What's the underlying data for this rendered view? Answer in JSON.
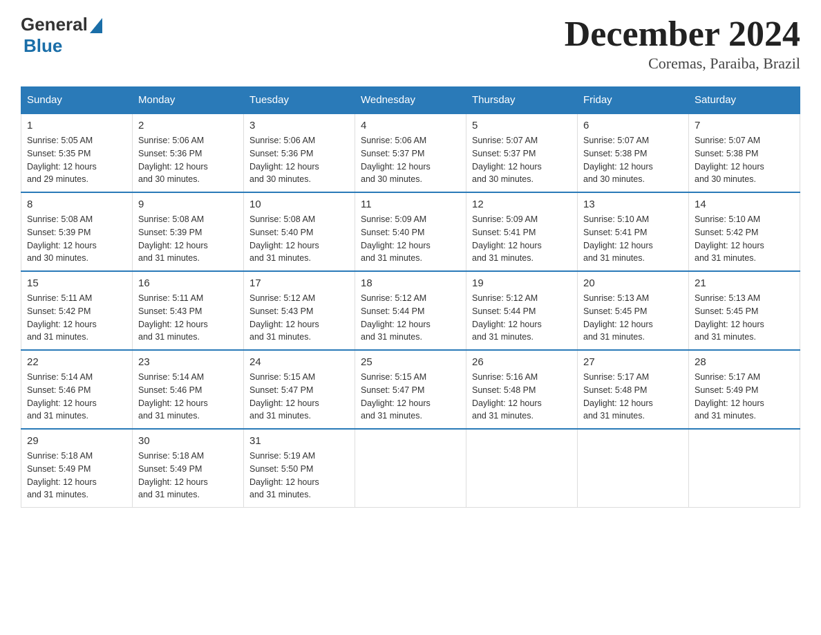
{
  "header": {
    "logo_general": "General",
    "logo_blue": "Blue",
    "title": "December 2024",
    "subtitle": "Coremas, Paraiba, Brazil"
  },
  "days_of_week": [
    "Sunday",
    "Monday",
    "Tuesday",
    "Wednesday",
    "Thursday",
    "Friday",
    "Saturday"
  ],
  "weeks": [
    [
      {
        "day": "1",
        "sunrise": "5:05 AM",
        "sunset": "5:35 PM",
        "daylight": "12 hours and 29 minutes."
      },
      {
        "day": "2",
        "sunrise": "5:06 AM",
        "sunset": "5:36 PM",
        "daylight": "12 hours and 30 minutes."
      },
      {
        "day": "3",
        "sunrise": "5:06 AM",
        "sunset": "5:36 PM",
        "daylight": "12 hours and 30 minutes."
      },
      {
        "day": "4",
        "sunrise": "5:06 AM",
        "sunset": "5:37 PM",
        "daylight": "12 hours and 30 minutes."
      },
      {
        "day": "5",
        "sunrise": "5:07 AM",
        "sunset": "5:37 PM",
        "daylight": "12 hours and 30 minutes."
      },
      {
        "day": "6",
        "sunrise": "5:07 AM",
        "sunset": "5:38 PM",
        "daylight": "12 hours and 30 minutes."
      },
      {
        "day": "7",
        "sunrise": "5:07 AM",
        "sunset": "5:38 PM",
        "daylight": "12 hours and 30 minutes."
      }
    ],
    [
      {
        "day": "8",
        "sunrise": "5:08 AM",
        "sunset": "5:39 PM",
        "daylight": "12 hours and 30 minutes."
      },
      {
        "day": "9",
        "sunrise": "5:08 AM",
        "sunset": "5:39 PM",
        "daylight": "12 hours and 31 minutes."
      },
      {
        "day": "10",
        "sunrise": "5:08 AM",
        "sunset": "5:40 PM",
        "daylight": "12 hours and 31 minutes."
      },
      {
        "day": "11",
        "sunrise": "5:09 AM",
        "sunset": "5:40 PM",
        "daylight": "12 hours and 31 minutes."
      },
      {
        "day": "12",
        "sunrise": "5:09 AM",
        "sunset": "5:41 PM",
        "daylight": "12 hours and 31 minutes."
      },
      {
        "day": "13",
        "sunrise": "5:10 AM",
        "sunset": "5:41 PM",
        "daylight": "12 hours and 31 minutes."
      },
      {
        "day": "14",
        "sunrise": "5:10 AM",
        "sunset": "5:42 PM",
        "daylight": "12 hours and 31 minutes."
      }
    ],
    [
      {
        "day": "15",
        "sunrise": "5:11 AM",
        "sunset": "5:42 PM",
        "daylight": "12 hours and 31 minutes."
      },
      {
        "day": "16",
        "sunrise": "5:11 AM",
        "sunset": "5:43 PM",
        "daylight": "12 hours and 31 minutes."
      },
      {
        "day": "17",
        "sunrise": "5:12 AM",
        "sunset": "5:43 PM",
        "daylight": "12 hours and 31 minutes."
      },
      {
        "day": "18",
        "sunrise": "5:12 AM",
        "sunset": "5:44 PM",
        "daylight": "12 hours and 31 minutes."
      },
      {
        "day": "19",
        "sunrise": "5:12 AM",
        "sunset": "5:44 PM",
        "daylight": "12 hours and 31 minutes."
      },
      {
        "day": "20",
        "sunrise": "5:13 AM",
        "sunset": "5:45 PM",
        "daylight": "12 hours and 31 minutes."
      },
      {
        "day": "21",
        "sunrise": "5:13 AM",
        "sunset": "5:45 PM",
        "daylight": "12 hours and 31 minutes."
      }
    ],
    [
      {
        "day": "22",
        "sunrise": "5:14 AM",
        "sunset": "5:46 PM",
        "daylight": "12 hours and 31 minutes."
      },
      {
        "day": "23",
        "sunrise": "5:14 AM",
        "sunset": "5:46 PM",
        "daylight": "12 hours and 31 minutes."
      },
      {
        "day": "24",
        "sunrise": "5:15 AM",
        "sunset": "5:47 PM",
        "daylight": "12 hours and 31 minutes."
      },
      {
        "day": "25",
        "sunrise": "5:15 AM",
        "sunset": "5:47 PM",
        "daylight": "12 hours and 31 minutes."
      },
      {
        "day": "26",
        "sunrise": "5:16 AM",
        "sunset": "5:48 PM",
        "daylight": "12 hours and 31 minutes."
      },
      {
        "day": "27",
        "sunrise": "5:17 AM",
        "sunset": "5:48 PM",
        "daylight": "12 hours and 31 minutes."
      },
      {
        "day": "28",
        "sunrise": "5:17 AM",
        "sunset": "5:49 PM",
        "daylight": "12 hours and 31 minutes."
      }
    ],
    [
      {
        "day": "29",
        "sunrise": "5:18 AM",
        "sunset": "5:49 PM",
        "daylight": "12 hours and 31 minutes."
      },
      {
        "day": "30",
        "sunrise": "5:18 AM",
        "sunset": "5:49 PM",
        "daylight": "12 hours and 31 minutes."
      },
      {
        "day": "31",
        "sunrise": "5:19 AM",
        "sunset": "5:50 PM",
        "daylight": "12 hours and 31 minutes."
      },
      null,
      null,
      null,
      null
    ]
  ],
  "labels": {
    "sunrise": "Sunrise:",
    "sunset": "Sunset:",
    "daylight": "Daylight:"
  }
}
